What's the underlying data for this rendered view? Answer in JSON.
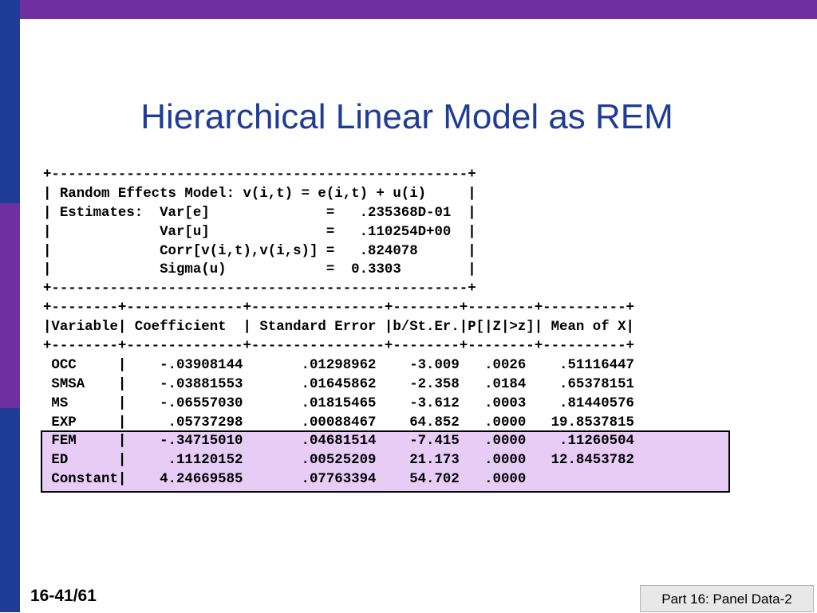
{
  "slide": {
    "title": "Hierarchical Linear Model as REM",
    "slide_number": "16-41/61",
    "footer": "Part 16: Panel Data-2"
  },
  "colors": {
    "top_bar": "#7030a0",
    "left_bar_blue": "#1f3c96",
    "left_bar_purple": "#7030a0",
    "title": "#1f3c96",
    "highlight_fill": "#e7ccf5"
  },
  "output": {
    "lines": [
      "+--------------------------------------------------+",
      "| Random Effects Model: v(i,t) = e(i,t) + u(i)     |",
      "| Estimates:  Var[e]              =   .235368D-01  |",
      "|             Var[u]              =   .110254D+00  |",
      "|             Corr[v(i,t),v(i,s)] =   .824078      |",
      "|             Sigma(u)            =  0.3303        |",
      "+--------------------------------------------------+",
      "+--------+--------------+----------------+--------+--------+----------+",
      "|Variable| Coefficient  | Standard Error |b/St.Er.|P[|Z|>z]| Mean of X|",
      "+--------+--------------+----------------+--------+--------+----------+",
      " OCC     |    -.03908144       .01298962    -3.009   .0026    .51116447",
      " SMSA    |    -.03881553       .01645862    -2.358   .0184    .65378151",
      " MS      |    -.06557030       .01815465    -3.612   .0003    .81440576",
      " EXP     |     .05737298       .00088467    64.852   .0000   19.8537815",
      " FEM     |    -.34715010       .04681514    -7.415   .0000    .11260504",
      " ED      |     .11120152       .00525209    21.173   .0000   12.8453782",
      " Constant|    4.24669585       .07763394    54.702   .0000"
    ]
  }
}
